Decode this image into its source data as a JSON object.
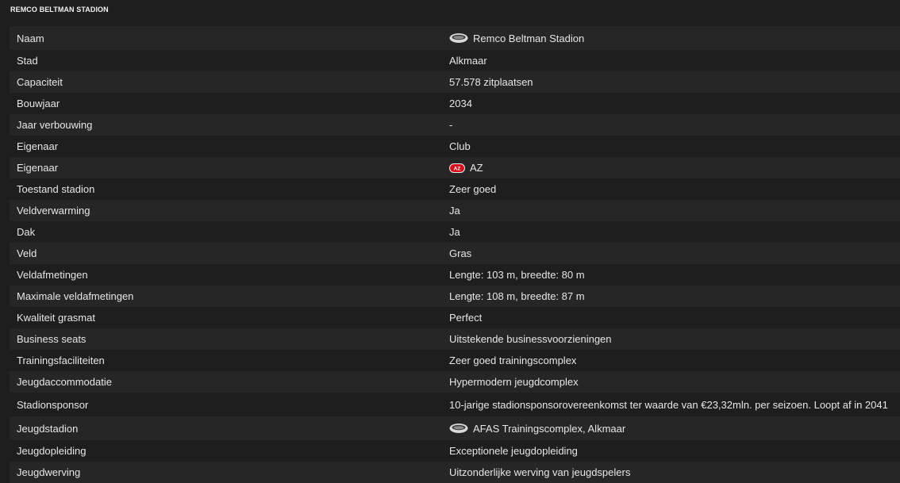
{
  "panel": {
    "title": "REMCO BELTMAN STADION"
  },
  "rows": [
    {
      "label": "Naam",
      "value": "Remco Beltman Stadion",
      "icon": "stadium-icon"
    },
    {
      "label": "Stad",
      "value": "Alkmaar"
    },
    {
      "label": "Capaciteit",
      "value": "57.578 zitplaatsen"
    },
    {
      "label": "Bouwjaar",
      "value": "2034"
    },
    {
      "label": "Jaar verbouwing",
      "value": "-"
    },
    {
      "label": "Eigenaar",
      "value": "Club"
    },
    {
      "label": "Eigenaar",
      "value": "AZ",
      "icon": "club-badge-icon"
    },
    {
      "label": "Toestand stadion",
      "value": "Zeer goed"
    },
    {
      "label": "Veldverwarming",
      "value": "Ja"
    },
    {
      "label": "Dak",
      "value": "Ja"
    },
    {
      "label": "Veld",
      "value": "Gras"
    },
    {
      "label": "Veldafmetingen",
      "value": "Lengte: 103 m, breedte: 80 m"
    },
    {
      "label": "Maximale veldafmetingen",
      "value": "Lengte: 108 m, breedte: 87 m"
    },
    {
      "label": "Kwaliteit grasmat",
      "value": "Perfect"
    },
    {
      "label": "Business seats",
      "value": "Uitstekende businessvoorzieningen"
    },
    {
      "label": "Trainingsfaciliteiten",
      "value": "Zeer goed trainingscomplex"
    },
    {
      "label": "Jeugdaccommodatie",
      "value": "Hypermodern jeugdcomplex"
    },
    {
      "label": "Stadionsponsor",
      "value": "10-jarige stadionsponsorovereenkomst ter waarde van €23,32mln. per seizoen. Loopt af in 2041"
    },
    {
      "label": "Jeugdstadion",
      "value": "AFAS Trainingscomplex, Alkmaar",
      "icon": "stadium-icon"
    },
    {
      "label": "Jeugdopleiding",
      "value": "Exceptionele jeugdopleiding"
    },
    {
      "label": "Jeugdwerving",
      "value": "Uitzonderlijke werving van jeugdspelers"
    }
  ],
  "colors": {
    "background": "#1e1e1e",
    "row_alt": "#262626",
    "text": "#e6e6e6",
    "badge_red": "#d4111b"
  }
}
